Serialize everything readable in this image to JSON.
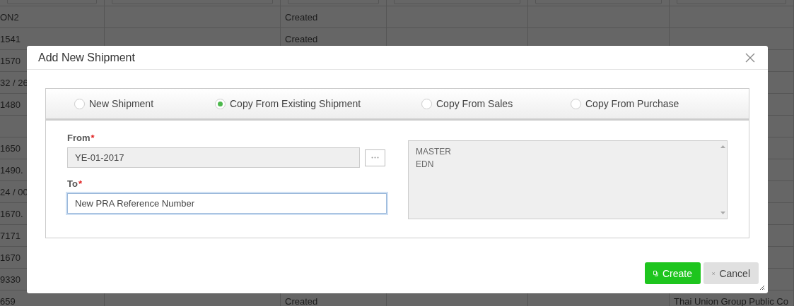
{
  "background_table": {
    "rows": [
      {
        "column_1": "ON2",
        "column_3": "Created"
      },
      {
        "column_1": "1541",
        "column_3": "Created"
      },
      {
        "column_1": "1570"
      },
      {
        "column_1": "32 / 26"
      },
      {
        "column_1": "1480"
      },
      {},
      {
        "column_1": "1650"
      },
      {
        "column_1": "1490."
      },
      {
        "column_1": "24 / 00"
      },
      {
        "column_1": "1670."
      },
      {
        "column_1": "7171"
      },
      {
        "column_1": "1670"
      },
      {
        "column_1": "9330"
      },
      {
        "column_1": "659",
        "column_3": "Created",
        "column_6": "Thai Union Group Public Co"
      }
    ]
  },
  "dialog": {
    "title": "Add New Shipment",
    "options": [
      {
        "label": "New Shipment",
        "selected": false
      },
      {
        "label": "Copy From Existing Shipment",
        "selected": true
      },
      {
        "label": "Copy From Sales",
        "selected": false
      },
      {
        "label": "Copy From Purchase",
        "selected": false
      }
    ],
    "from": {
      "label": "From",
      "required_mark": "*",
      "value": "YE-01-2017",
      "disabled": true
    },
    "to": {
      "label": "To",
      "required_mark": "*",
      "value": "New PRA Reference Number",
      "focused": true
    },
    "list_items": [
      "MASTER",
      "EDN"
    ],
    "buttons": [
      {
        "label": "Create",
        "kind": "primary"
      },
      {
        "label": "Cancel",
        "kind": "secondary"
      }
    ]
  }
}
